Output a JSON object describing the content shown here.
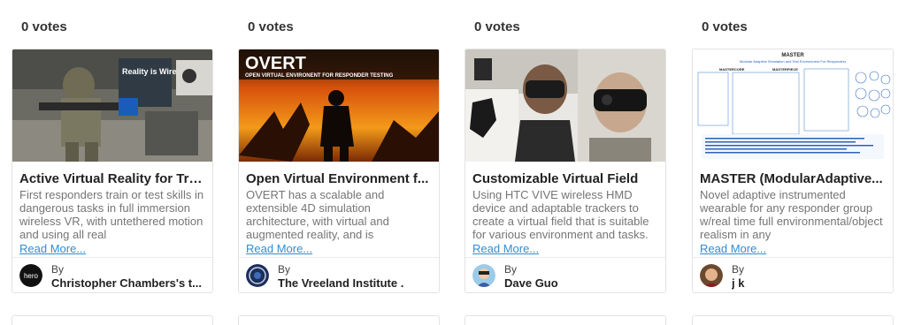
{
  "cards": [
    {
      "votes": "0 votes",
      "title": "Active Virtual Reality for Tra...",
      "description": "First responders train or test skills in dangerous tasks in full immersion wireless VR, with untethered motion and using all real",
      "read_more": "Read More...",
      "by_label": "By",
      "author": "Christopher Chambers's t...",
      "avatar_text": "hero",
      "thumb_text": "Reality is Wireless"
    },
    {
      "votes": "0 votes",
      "title": "Open Virtual Environment f...",
      "description": "OVERT has a scalable and extensible 4D simulation architecture, with virtual and augmented reality, and is",
      "read_more": "Read More...",
      "by_label": "By",
      "author": "The Vreeland Institute .",
      "thumb_title": "OVERT",
      "thumb_subtitle": "OPEN VIRTUAL ENVIRONENT FOR RESPONDER TESTING"
    },
    {
      "votes": "0 votes",
      "title": "Customizable Virtual Field",
      "description": "Using HTC VIVE wireless HMD device and adaptable trackers to create a virtual field that is suitable for various environment and tasks.",
      "read_more": "Read More...",
      "by_label": "By",
      "author": "Dave Guo"
    },
    {
      "votes": "0 votes",
      "title": "MASTER (ModularAdaptive...",
      "description": "Novel adaptive instrumented wearable for any responder group w/real time full environmental/object realism in any",
      "read_more": "Read More...",
      "by_label": "By",
      "author": "j k",
      "thumb_title": "MASTER",
      "thumb_subtitle": "Modular Adaptive Simulation and Test Environment For Responders",
      "thumb_labels": [
        "MASTERCORE",
        "MASTERPIECE"
      ]
    }
  ],
  "colors": {
    "link": "#2a8fd8",
    "text_muted": "#757575",
    "border": "#e3e3e3"
  }
}
